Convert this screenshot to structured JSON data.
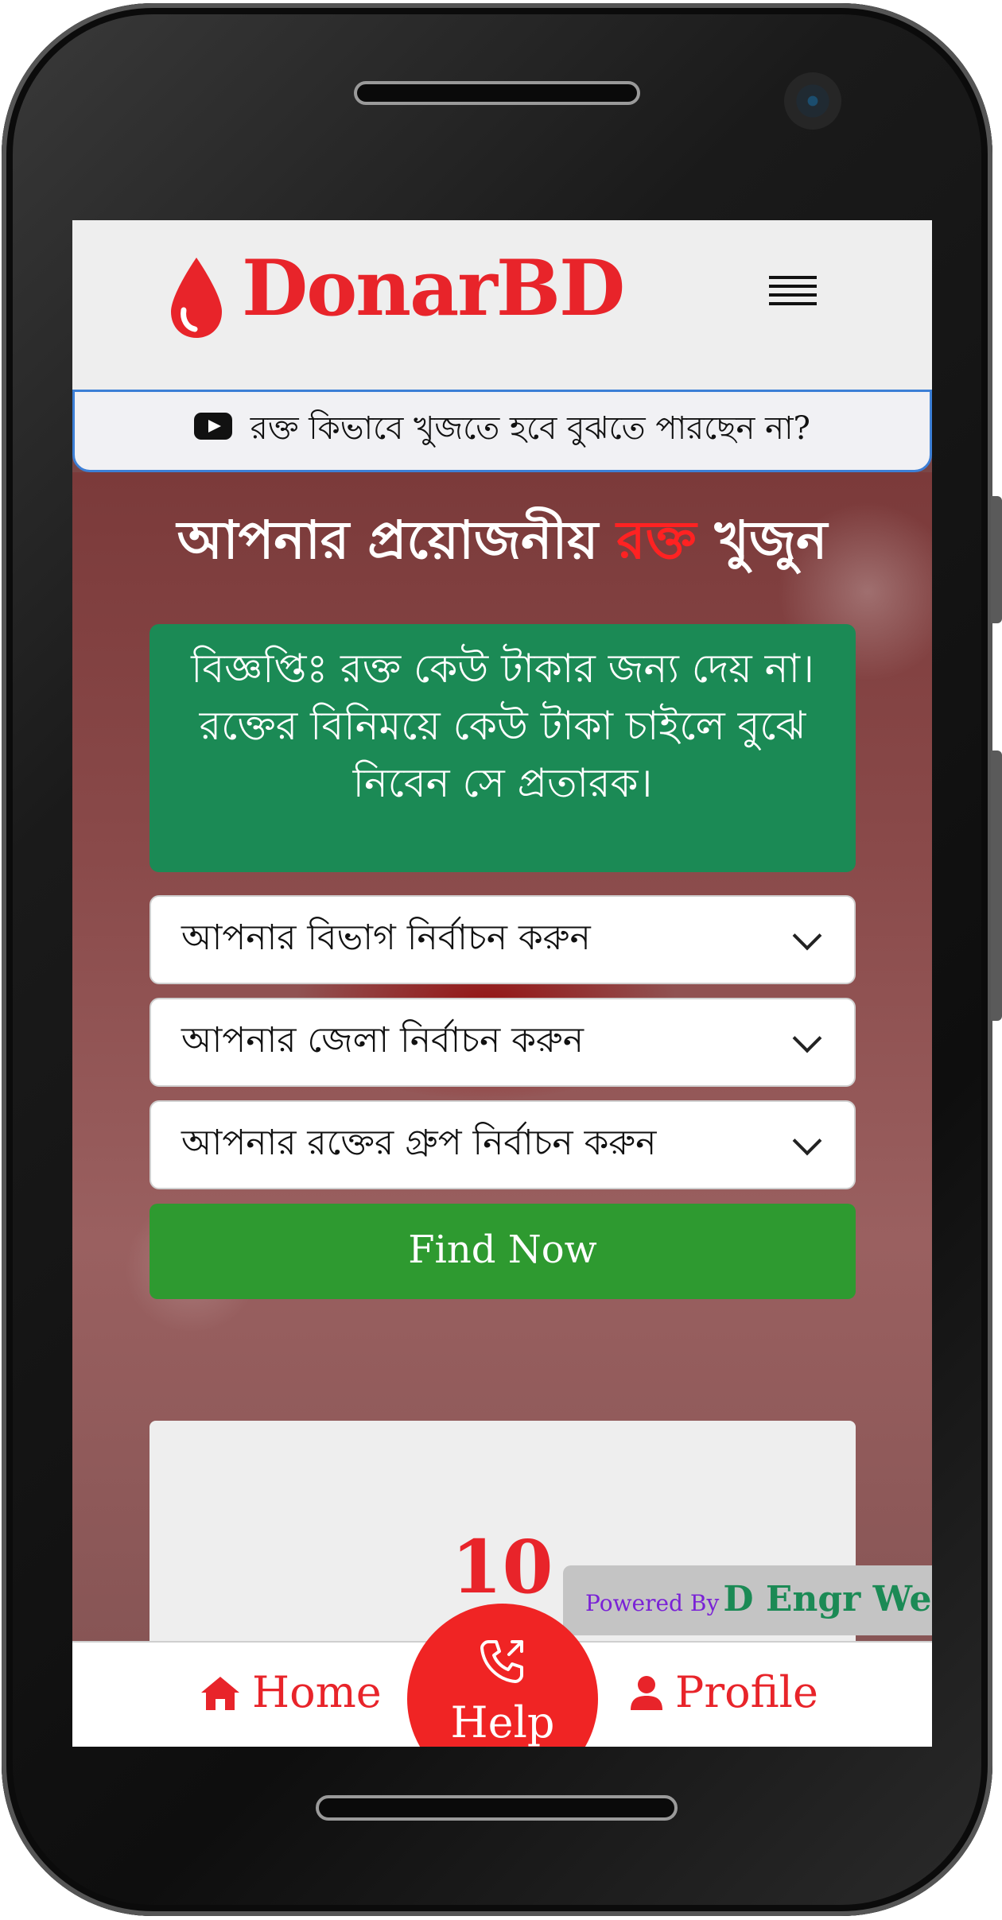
{
  "header": {
    "brand": "DonarBD"
  },
  "video_bar": {
    "text": "রক্ত কিভাবে খুজতে হবে বুঝতে পারছেন না?"
  },
  "hero": {
    "title_part1": "আপনার প্রয়োজনীয় ",
    "title_accent": "রক্ত",
    "title_part2": " খুজুন"
  },
  "notice": {
    "text": "বিজ্ঞপ্তিঃ রক্ত কেউ টাকার জন্য দেয় না। রক্তের বিনিময়ে কেউ টাকা চাইলে বুঝে নিবেন সে প্রতারক।"
  },
  "form": {
    "division_select": "আপনার বিভাগ নির্বাচন করুন",
    "district_select": "আপনার জেলা নির্বাচন করুন",
    "blood_group_select": "আপনার রক্তের গ্রুপ নির্বাচন করুন",
    "find_button": "Find Now"
  },
  "stats": {
    "count": "10"
  },
  "powered_by": {
    "prefix": "Powered By",
    "name": "D Engr Web"
  },
  "bottom_nav": {
    "home": "Home",
    "help": "Help",
    "profile": "Profile"
  },
  "colors": {
    "brand_red": "#e8242a",
    "notice_green": "#1b8a55",
    "button_green": "#2e9a30",
    "help_red": "#f02424",
    "powered_purple": "#7a22d6"
  }
}
